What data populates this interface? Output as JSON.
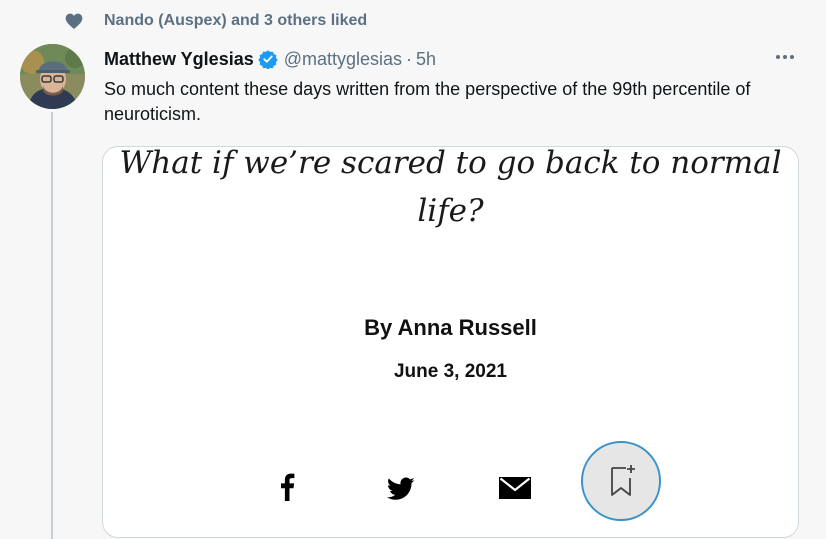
{
  "social_context": {
    "icon": "heart-icon",
    "text": "Nando (Auspex) and 3 others liked"
  },
  "tweet": {
    "display_name": "Matthew Yglesias",
    "verified": true,
    "handle": "@mattyglesias",
    "separator": "·",
    "time": "5h",
    "text": "So much content these days written from the perspective of the 99th percentile of neuroticism."
  },
  "card": {
    "title": "What if we’re scared to go back to normal life?",
    "byline": "By Anna Russell",
    "date": "June 3, 2021",
    "share_icons": [
      "facebook-icon",
      "twitter-icon",
      "email-icon",
      "bookmark-icon"
    ]
  },
  "colors": {
    "secondary_text": "#5b7083",
    "verified_blue": "#1d9bf0",
    "bookmark_ring": "#3b92c9"
  }
}
